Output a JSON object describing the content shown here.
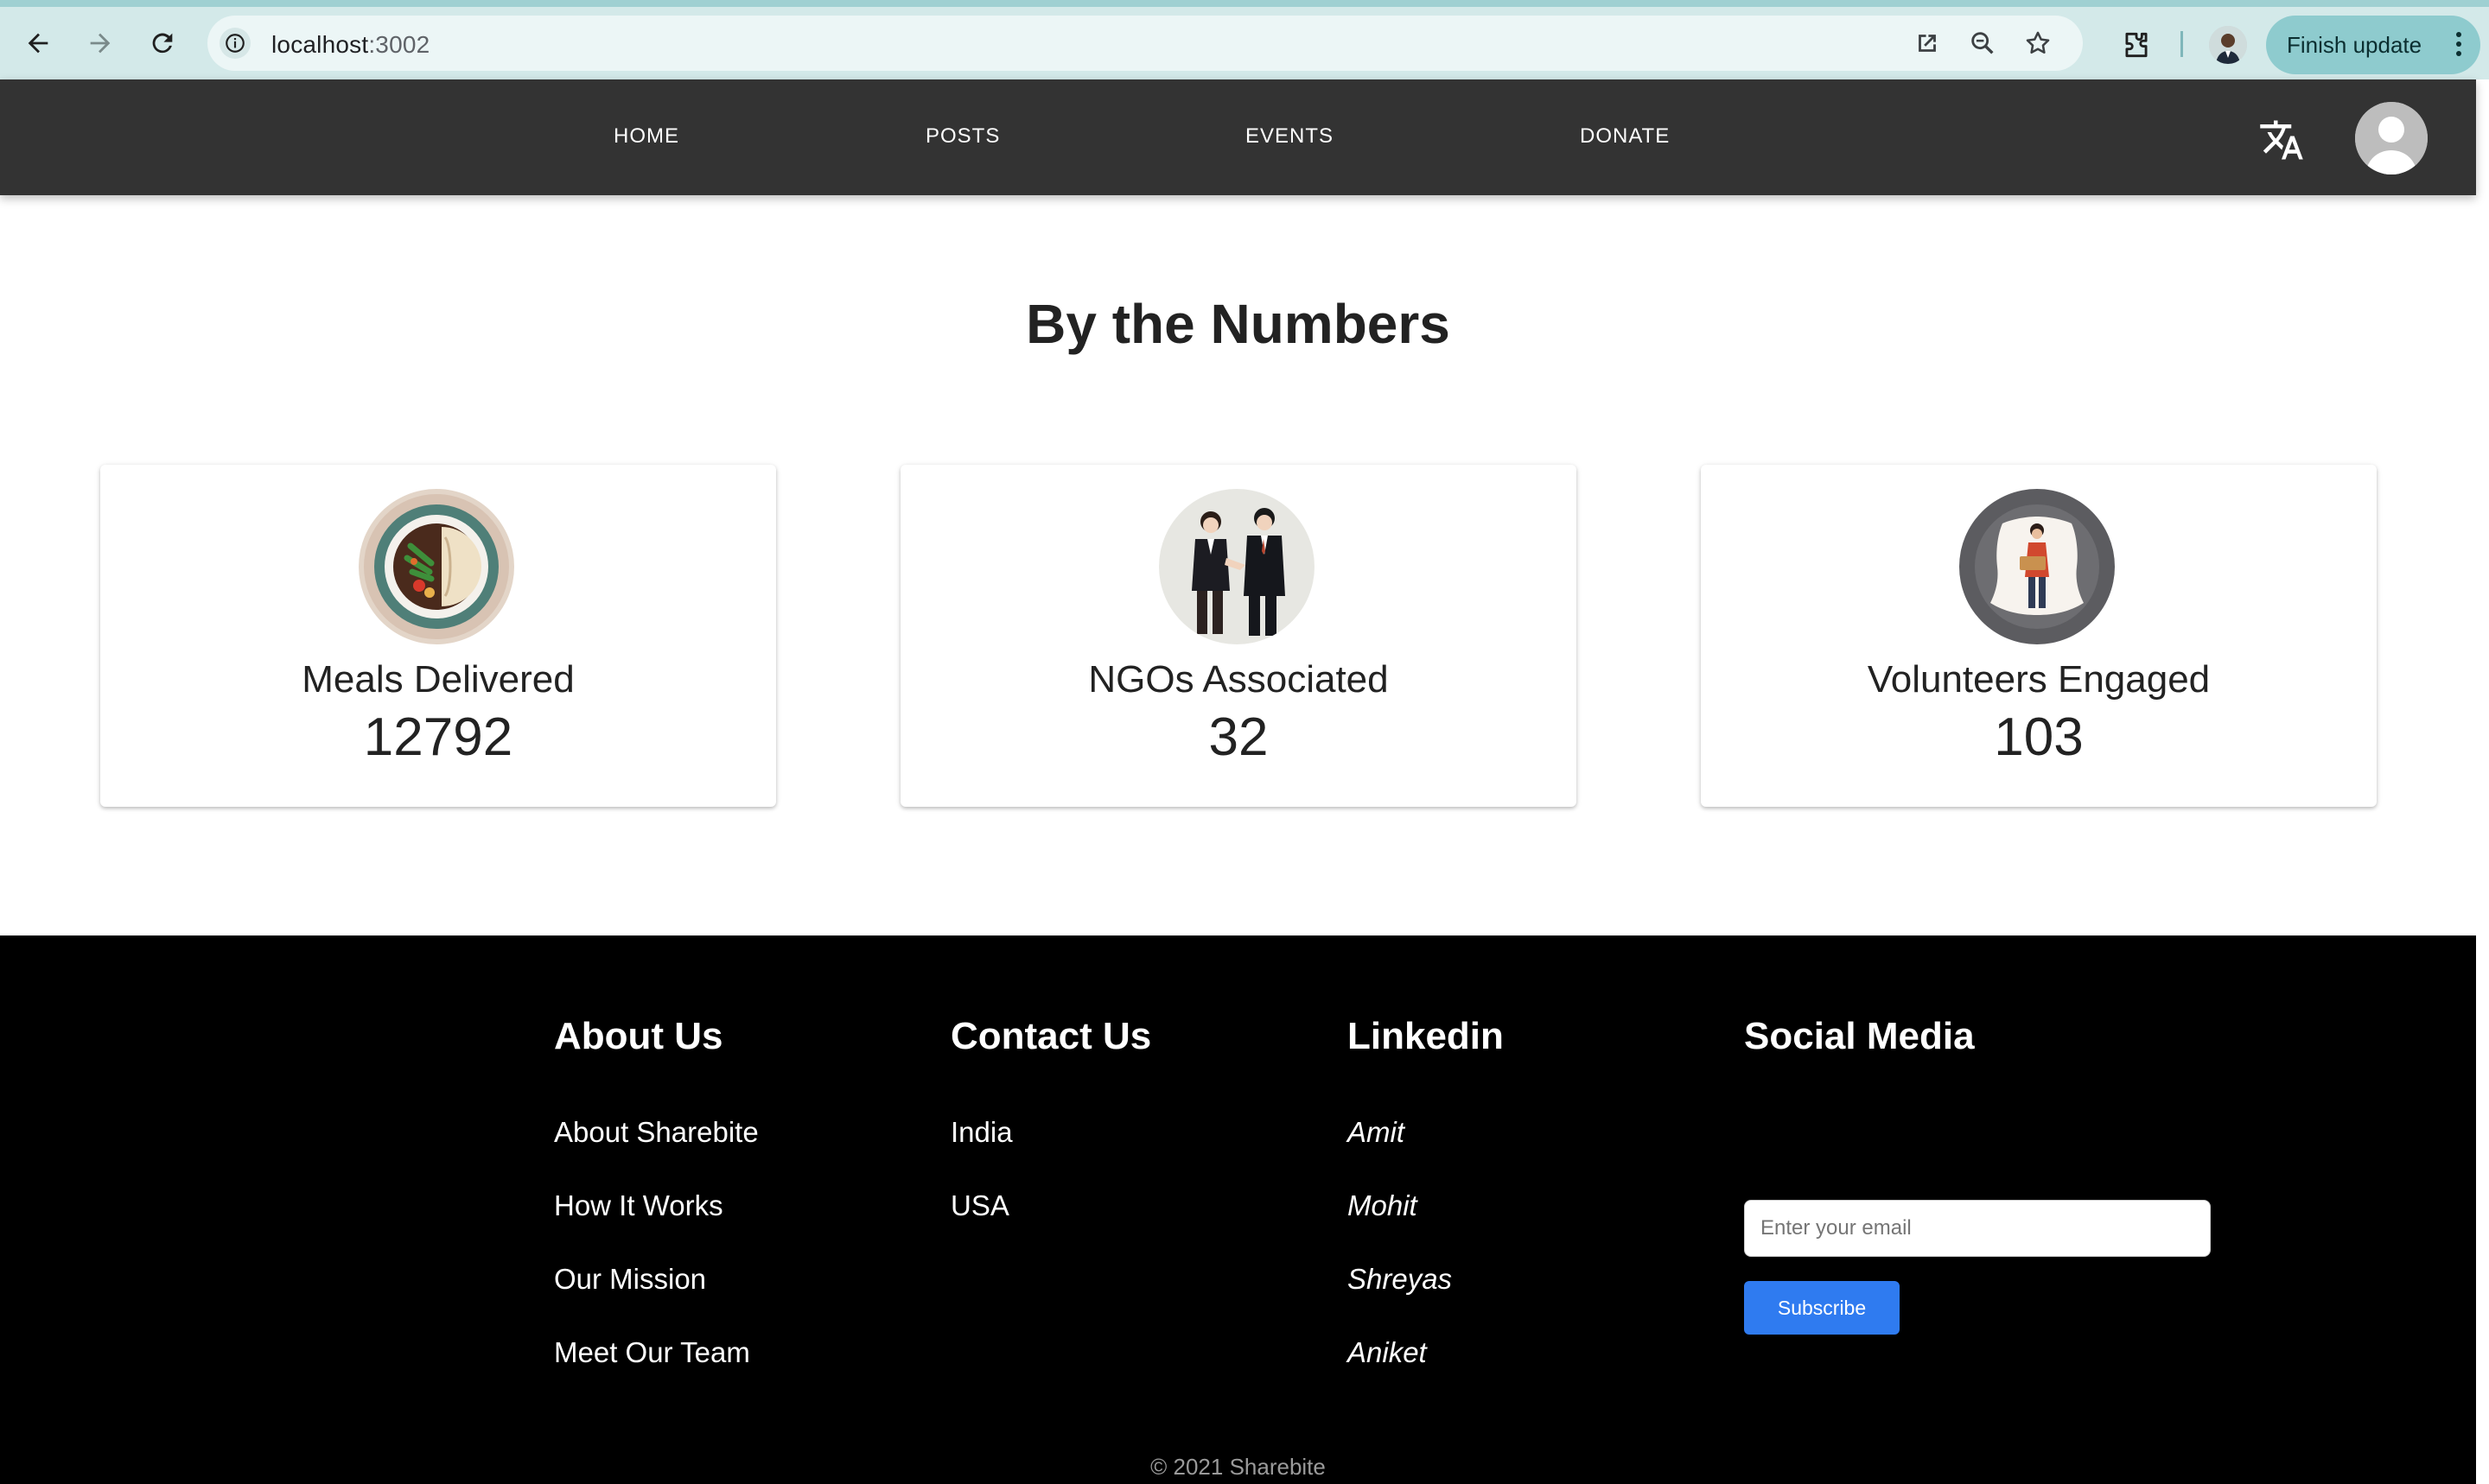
{
  "browser": {
    "url_host": "localhost",
    "url_port": ":3002",
    "update_label": "Finish update"
  },
  "appbar": {
    "nav": [
      "HOME",
      "POSTS",
      "EVENTS",
      "DONATE"
    ],
    "icons": {
      "translate": "translate-icon",
      "avatar": "account-avatar-icon"
    }
  },
  "numbers": {
    "title": "By the Numbers",
    "stats": [
      {
        "label": "Meals Delivered",
        "value": "12792",
        "icon": "meal-plate-icon"
      },
      {
        "label": "NGOs Associated",
        "value": "32",
        "icon": "handshake-icon"
      },
      {
        "label": "Volunteers Engaged",
        "value": "103",
        "icon": "volunteer-icon"
      }
    ]
  },
  "footer": {
    "about": {
      "heading": "About Us",
      "links": [
        "About Sharebite",
        "How It Works",
        "Our Mission",
        "Meet Our Team"
      ]
    },
    "contact": {
      "heading": "Contact Us",
      "links": [
        "India",
        "USA"
      ]
    },
    "linkedin": {
      "heading": "Linkedin",
      "links": [
        "Amit",
        "Mohit",
        "Shreyas",
        "Aniket"
      ]
    },
    "social": {
      "heading": "Social Media",
      "email_placeholder": "Enter your email",
      "subscribe_label": "Subscribe"
    },
    "copyright": "© 2021 Sharebite"
  },
  "colors": {
    "appbar": "#333333",
    "footer": "#000000",
    "subscribe": "#2f7bf0",
    "chrome": "#d3e9e9"
  }
}
